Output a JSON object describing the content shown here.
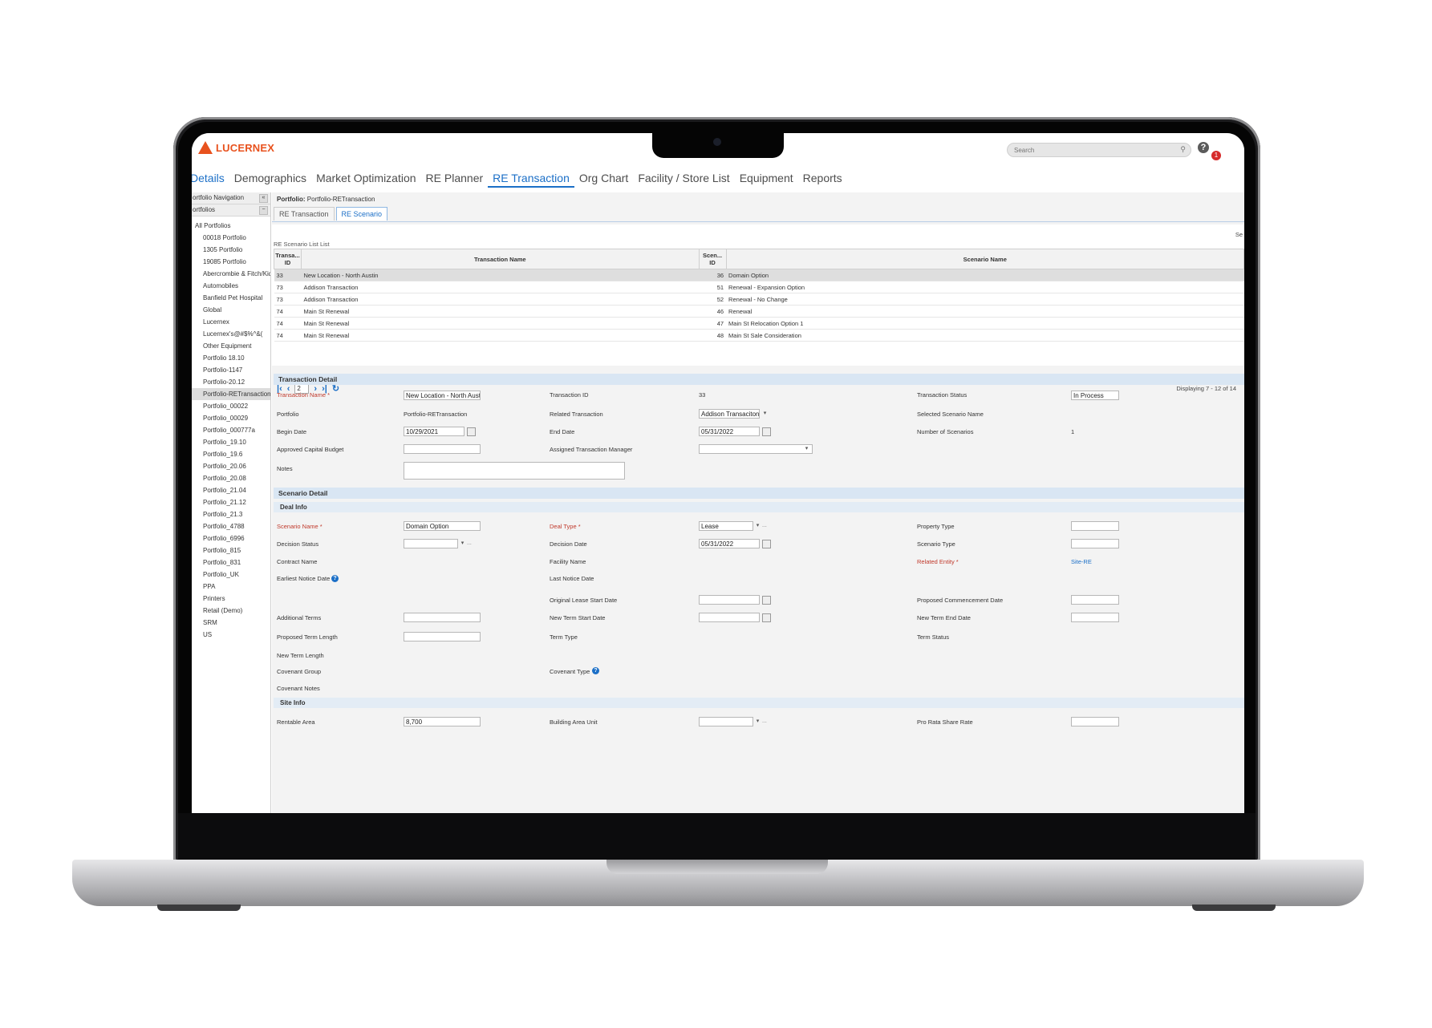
{
  "app": {
    "logo_text": "LUCERNEX",
    "search_placeholder": "Search",
    "help_glyph": "?",
    "notif_count": "1"
  },
  "nav": {
    "items": [
      "Details",
      "Demographics",
      "Market Optimization",
      "RE Planner",
      "RE Transaction",
      "Org Chart",
      "Facility / Store List",
      "Equipment",
      "Reports"
    ],
    "active": "RE Transaction"
  },
  "sidebar": {
    "nav_title": "ortfolio Navigation",
    "section_title": "ortfolios",
    "root": "All Portfolios",
    "items": [
      "00018 Portfolio",
      "1305 Portfolio",
      "19085 Portfolio",
      "Abercrombie & Fitch/Kids",
      "Automobiles",
      "Banfield Pet Hospital",
      "Global",
      "Lucernex",
      "Lucernex's@#$%^&(",
      "Other Equipment",
      "Portfolio 18.10",
      "Portfolio-1147",
      "Portfolio-20.12",
      "Portfolio-RETransaction",
      "Portfolio_00022",
      "Portfolio_00029",
      "Portfolio_000777a",
      "Portfolio_19.10",
      "Portfolio_19.6",
      "Portfolio_20.06",
      "Portfolio_20.08",
      "Portfolio_21.04",
      "Portfolio_21.12",
      "Portfolio_21.3",
      "Portfolio_4788",
      "Portfolio_6996",
      "Portfolio_815",
      "Portfolio_831",
      "Portfolio_UK",
      "PPA",
      "Printers",
      "Retail (Demo)",
      "SRM",
      "US"
    ],
    "selected": "Portfolio-RETransaction"
  },
  "content": {
    "portfolio_label": "Portfolio:",
    "portfolio_value": "Portfolio-RETransaction",
    "tabs": [
      "RE Transaction",
      "RE Scenario"
    ],
    "active_tab": "RE Scenario",
    "list_title": "RE Scenario List List",
    "columns": [
      "Transa... ID",
      "Transaction Name",
      "Scen... ID",
      "Scenario Name"
    ],
    "rows": [
      {
        "tid": "33",
        "tname": "New Location - North Austin",
        "sid": "36",
        "sname": "Domain Option"
      },
      {
        "tid": "73",
        "tname": "Addison Transaction",
        "sid": "51",
        "sname": "Renewal - Expansion Option"
      },
      {
        "tid": "73",
        "tname": "Addison Transaction",
        "sid": "52",
        "sname": "Renewal - No Change"
      },
      {
        "tid": "74",
        "tname": "Main St Renewal",
        "sid": "46",
        "sname": "Renewal"
      },
      {
        "tid": "74",
        "tname": "Main St Renewal",
        "sid": "47",
        "sname": "Main St Relocation Option 1"
      },
      {
        "tid": "74",
        "tname": "Main St Renewal",
        "sid": "48",
        "sname": "Main St Sale Consideration"
      }
    ],
    "page_number": "2",
    "displaying": "Displaying 7 - 12 of 14",
    "right_cut_text": "Se"
  },
  "transaction_detail": {
    "title": "Transaction Detail",
    "transaction_name_label": "Transaction Name *",
    "transaction_name_value": "New Location - North Austin",
    "transaction_id_label": "Transaction ID",
    "transaction_id_value": "33",
    "transaction_status_label": "Transaction Status",
    "transaction_status_value": "In Process",
    "portfolio_label": "Portfolio",
    "portfolio_value": "Portfolio-RETransaction",
    "related_transaction_label": "Related Transaction",
    "related_transaction_value": "Addison Transaciton",
    "selected_scenario_label": "Selected Scenario Name",
    "begin_date_label": "Begin Date",
    "begin_date_value": "10/29/2021",
    "end_date_label": "End Date",
    "end_date_value": "05/31/2022",
    "number_of_scenarios_label": "Number of Scenarios",
    "number_of_scenarios_value": "1",
    "approved_budget_label": "Approved Capital Budget",
    "assigned_manager_label": "Assigned Transaction Manager",
    "notes_label": "Notes"
  },
  "scenario_detail": {
    "title": "Scenario Detail",
    "deal_info_title": "Deal Info",
    "scenario_name_label": "Scenario Name *",
    "scenario_name_value": "Domain Option",
    "deal_type_label": "Deal Type *",
    "deal_type_value": "Lease",
    "property_type_label": "Property Type",
    "decision_status_label": "Decision Status",
    "decision_date_label": "Decision Date",
    "decision_date_value": "05/31/2022",
    "scenario_type_label": "Scenario Type",
    "contract_name_label": "Contract Name",
    "facility_name_label": "Facility Name",
    "related_entity_label": "Related Entity *",
    "related_entity_value": "Site-RE",
    "earliest_notice_label": "Earliest Notice Date",
    "last_notice_label": "Last Notice Date",
    "original_lease_start_label": "Original Lease Start Date",
    "proposed_commencement_label": "Proposed Commencement Date",
    "additional_terms_label": "Additional Terms",
    "new_term_start_label": "New Term Start Date",
    "new_term_end_label": "New Term End Date",
    "proposed_term_length_label": "Proposed Term Length",
    "term_type_label": "Term Type",
    "term_status_label": "Term Status",
    "new_term_length_label": "New Term Length",
    "covenant_group_label": "Covenant Group",
    "covenant_type_label": "Covenant Type",
    "covenant_notes_label": "Covenant Notes",
    "site_info_title": "Site Info",
    "rentable_area_label": "Rentable Area",
    "rentable_area_value": "8,700",
    "building_area_unit_label": "Building Area Unit",
    "pro_rata_label": "Pro Rata Share Rate"
  },
  "colors": {
    "accent": "#1b6fc7",
    "brand": "#e8521e",
    "required": "#c0392b",
    "section_bg": "#d9e6f3"
  }
}
